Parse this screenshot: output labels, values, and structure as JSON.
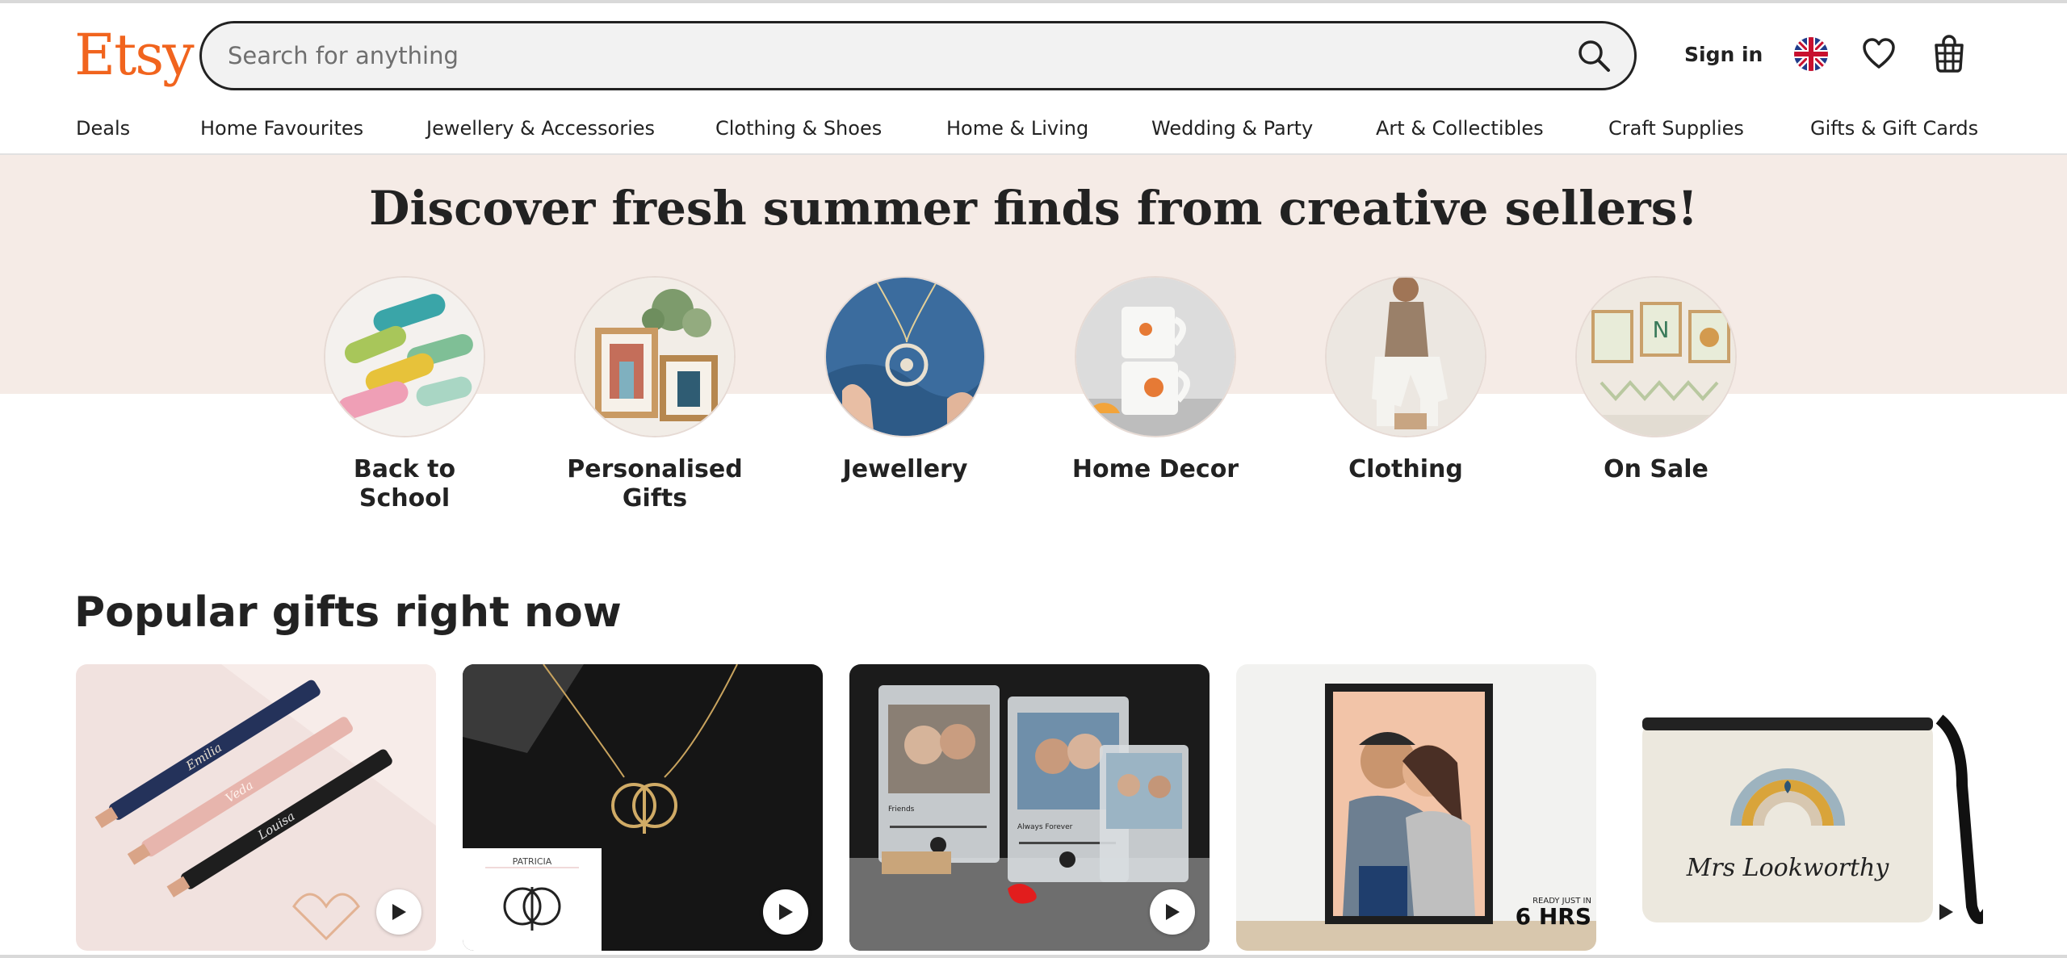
{
  "header": {
    "logo": "Etsy",
    "search": {
      "placeholder": "Search for anything"
    },
    "sign_in": "Sign in",
    "icons": [
      "uk-flag-icon",
      "heart-icon",
      "shopping-bag-icon",
      "search-icon"
    ]
  },
  "nav": [
    "Deals",
    "Home Favourites",
    "Jewellery & Accessories",
    "Clothing & Shoes",
    "Home & Living",
    "Wedding & Party",
    "Art & Collectibles",
    "Craft Supplies",
    "Gifts & Gift Cards"
  ],
  "hero": {
    "title": "Discover fresh summer finds from creative sellers!",
    "categories": [
      {
        "label": "Back to School"
      },
      {
        "label": "Personalised Gifts"
      },
      {
        "label": "Jewellery"
      },
      {
        "label": "Home Decor"
      },
      {
        "label": "Clothing"
      },
      {
        "label": "On Sale"
      }
    ]
  },
  "popular": {
    "title": "Popular gifts right now",
    "items": [
      {
        "image_text": [
          "Emilia",
          "Veda",
          "Louisa"
        ],
        "has_video": true
      },
      {
        "image_text": [
          "PATRICIA"
        ],
        "has_video": true
      },
      {
        "image_text": [
          "Friends",
          "Always Forever"
        ],
        "has_video": true
      },
      {
        "image_text": [
          "READY JUST IN",
          "6 HRS"
        ],
        "has_video": false
      },
      {
        "image_text": [
          "Mrs Lookworthy"
        ],
        "has_video": true
      }
    ]
  },
  "colors": {
    "brand": "#F1641E",
    "hero_band": "#F5EBE6",
    "text": "#222222",
    "search_bg": "#f2f2f2"
  }
}
